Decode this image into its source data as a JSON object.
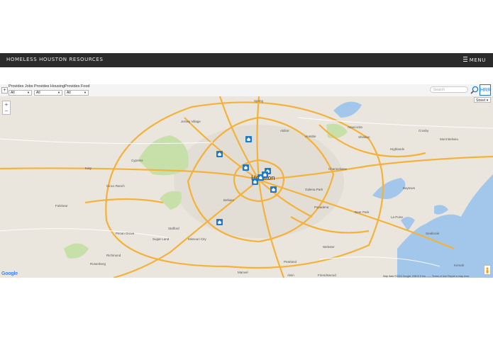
{
  "header": {
    "brand": "HOMELESS HOUSTON RESOURCES",
    "menu_label": "MENU"
  },
  "filters": [
    {
      "label": "Provides Jobs",
      "value": "All"
    },
    {
      "label": "Provides Housing",
      "value": "All"
    },
    {
      "label": "Provides Food",
      "value": "All"
    }
  ],
  "search": {
    "placeholder": "Search"
  },
  "hrr_button": "HRR",
  "map": {
    "type_label": "Street",
    "zoom_in": "+",
    "zoom_out": "−",
    "logo": "Google",
    "attribution": "Map data ©2016 Google, INEGI   5 km ⎯⎯⎯⎯   Terms of Use   Report a map error",
    "center_label": "Houston",
    "place_labels": [
      "Jersey Village",
      "Cypress",
      "Katy",
      "Cinco Ranch",
      "Fulshear",
      "Sugar Land",
      "Missouri City",
      "Rosenberg",
      "Richmond",
      "Pearland",
      "Pasadena",
      "Baytown",
      "La Porte",
      "Humble",
      "Spring",
      "Atascocita",
      "Channelview",
      "Bellaire",
      "Friendswood",
      "Kemah",
      "Alvin",
      "Manvel",
      "Mont Belvieu",
      "Galena Park",
      "Deer Park",
      "Seabrook",
      "Stafford",
      "Pecan Grove",
      "Highlands",
      "Aldine",
      "Sheldon",
      "Crosby",
      "Webster"
    ],
    "markers": [
      "marker",
      "marker",
      "marker",
      "marker",
      "marker",
      "marker",
      "marker",
      "marker",
      "marker"
    ]
  },
  "colors": {
    "header_bg": "#2b2b2b",
    "marker": "#1f78c8",
    "road": "#f4b23a",
    "water": "#a3c7ea",
    "park": "#c7dfa8"
  }
}
